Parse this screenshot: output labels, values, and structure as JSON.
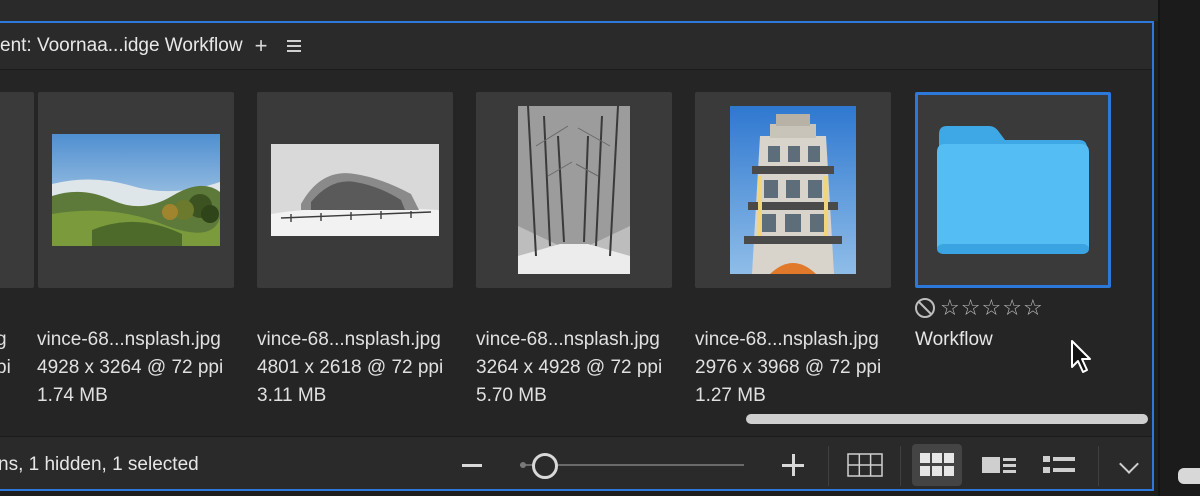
{
  "panel": {
    "title": "ent: Voornaa...idge Workflow",
    "add_label": "+",
    "menu_icon": "hamburger-menu-icon"
  },
  "items": [
    {
      "name": "vince-68...nsplash.jpg",
      "dims": "4928 x 3264 @ 72 ppi",
      "size": "1.74 MB"
    },
    {
      "name": "vince-68...nsplash.jpg",
      "dims": "4801 x 2618 @ 72 ppi",
      "size": "3.11 MB"
    },
    {
      "name": "vince-68...nsplash.jpg",
      "dims": "3264 x 4928 @ 72 ppi",
      "size": "5.70 MB"
    },
    {
      "name": "vince-68...nsplash.jpg",
      "dims": "2976 x 3968 @ 72 ppi",
      "size": "1.27 MB"
    }
  ],
  "partial_item": {
    "name_tail": "g",
    "dims_tail": "pi"
  },
  "folder": {
    "name": "Workflow",
    "icon": "folder-icon",
    "rating_stars": 5,
    "color": "#4db3f0"
  },
  "footer": {
    "status": "ns, 1 hidden, 1 selected",
    "zoom_level_fraction": 0.1
  },
  "colors": {
    "accent": "#2d78db",
    "panel_bg": "#252525",
    "thumb_bg": "#3a3a3a"
  },
  "icons": {
    "zoom_out": "minus-icon",
    "zoom_in": "plus-icon",
    "grid_view": "grid-view-icon",
    "thumbnail_view": "thumbnail-view-icon",
    "details_view": "details-view-icon",
    "list_view": "list-view-icon",
    "more": "chevron-down-icon",
    "reject": "reject-icon",
    "star": "star-icon",
    "pointer": "mouse-pointer-icon"
  }
}
